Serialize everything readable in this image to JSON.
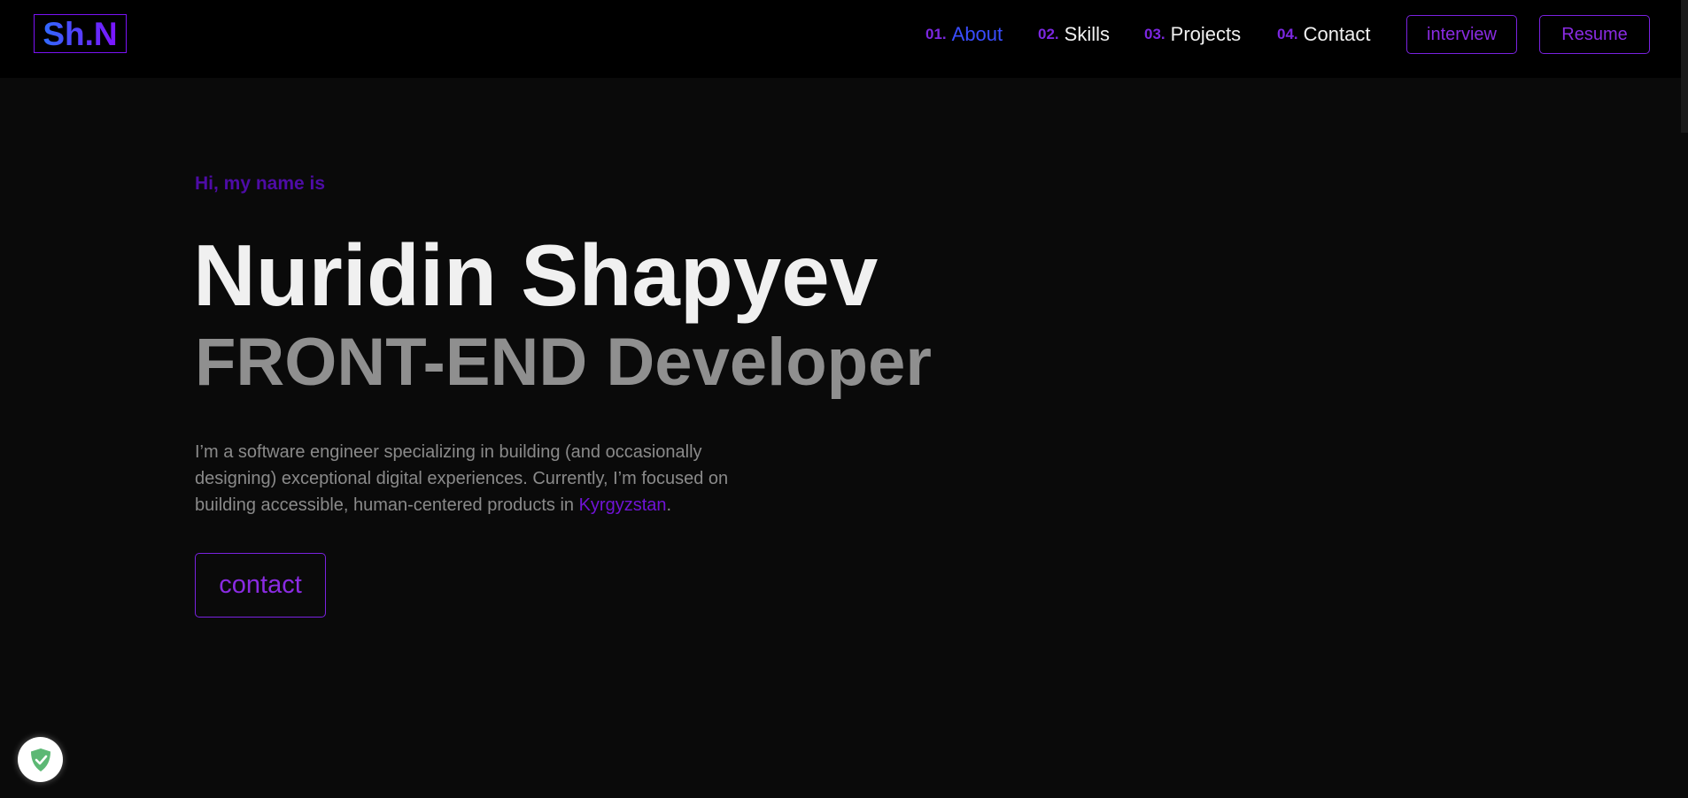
{
  "header": {
    "logo": "Sh.N",
    "nav": [
      {
        "num": "01.",
        "label": "About",
        "active": true
      },
      {
        "num": "02.",
        "label": "Skills"
      },
      {
        "num": "03.",
        "label": "Projects"
      },
      {
        "num": "04.",
        "label": "Contact"
      }
    ],
    "interview_label": "interview",
    "resume_label": "Resume"
  },
  "hero": {
    "greeting": "Hi, my name is",
    "name": "Nuridin Shapyev",
    "role": "FRONT-END Developer",
    "description_before": "I’m a software engineer specializing in building (and occasionally designing) exceptional digital experiences. Currently, I’m focused on building accessible, human-centered products in ",
    "description_highlight": "Kyrgyzstan",
    "description_after": ".",
    "contact_label": "contact"
  },
  "colors": {
    "accent": "#7a22e0",
    "active_nav": "#3a4dff",
    "background": "#0a0a0a",
    "header": "#000000"
  },
  "extension_badge": {
    "icon": "shield-check-icon"
  }
}
